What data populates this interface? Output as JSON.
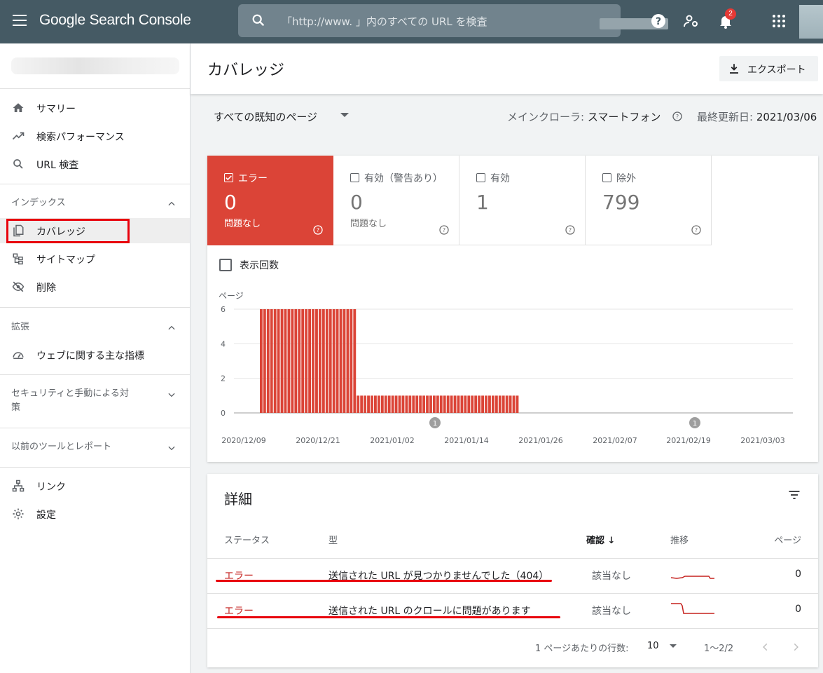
{
  "app": {
    "logo_text": "Google Search Console"
  },
  "search": {
    "placeholder": "「http://www.               」内のすべての URL を検査"
  },
  "topbar": {
    "notifications_count": "2",
    "icons": [
      "menu-icon",
      "search-icon",
      "help-icon",
      "admin-icon",
      "bell-icon",
      "apps-icon"
    ]
  },
  "sidebar": {
    "top_items": [
      {
        "label": "サマリー",
        "icon": "home-icon"
      },
      {
        "label": "検索パフォーマンス",
        "icon": "trending-icon"
      },
      {
        "label": "URL 検査",
        "icon": "search-icon"
      }
    ],
    "index_section": "インデックス",
    "index_items": [
      {
        "label": "カバレッジ",
        "icon": "copy-icon",
        "active": true
      },
      {
        "label": "サイトマップ",
        "icon": "sitemap-icon"
      },
      {
        "label": "削除",
        "icon": "visibility-off-icon"
      }
    ],
    "enhancements_section": "拡張",
    "enhancements_items": [
      {
        "label": "ウェブに関する主な指標",
        "icon": "speed-icon"
      }
    ],
    "security_section": "セキュリティと手動による対策",
    "legacy_section": "以前のツールとレポート",
    "bottom_items": [
      {
        "label": "リンク",
        "icon": "links-icon"
      },
      {
        "label": "設定",
        "icon": "settings-icon"
      }
    ]
  },
  "header": {
    "title": "カバレッジ",
    "export_label": "エクスポート"
  },
  "filter": {
    "pages_select": "すべての既知のページ",
    "crawler_label": "メインクローラ:",
    "crawler_value": "スマートフォン",
    "updated_label": "最終更新日:",
    "updated_value": "2021/03/06"
  },
  "tiles": [
    {
      "label": "エラー",
      "count": "0",
      "sub": "問題なし",
      "checked": true,
      "color": "#db4437"
    },
    {
      "label": "有効（警告あり）",
      "count": "0",
      "sub": "問題なし",
      "checked": false
    },
    {
      "label": "有効",
      "count": "1",
      "sub": "",
      "checked": false
    },
    {
      "label": "除外",
      "count": "799",
      "sub": "",
      "checked": false
    }
  ],
  "impressions_label": "表示回数",
  "chart_data": {
    "type": "bar",
    "ylabel": "ページ",
    "yticks": [
      0,
      2,
      4,
      6
    ],
    "ylim": [
      0,
      6
    ],
    "xtick_labels": [
      "2020/12/09",
      "2020/12/21",
      "2021/01/02",
      "2021/01/14",
      "2021/01/26",
      "2021/02/07",
      "2021/02/19",
      "2021/03/03"
    ],
    "series": [
      {
        "values": [
          6,
          6,
          6,
          6,
          6,
          6,
          6,
          6,
          6,
          6,
          6,
          6,
          6,
          6,
          6,
          6,
          6,
          6,
          6,
          6,
          6,
          6,
          6,
          6,
          6,
          6,
          6,
          6,
          1,
          1,
          1,
          1,
          1,
          1,
          1,
          1,
          1,
          1,
          1,
          1,
          1,
          1,
          1,
          1,
          1,
          1,
          1,
          1,
          1,
          1,
          1,
          1,
          1,
          1,
          1,
          1,
          1,
          1,
          1,
          1,
          1,
          1,
          1,
          1,
          1,
          1,
          1,
          1,
          1,
          1,
          1,
          1,
          1,
          1,
          1,
          0,
          0,
          0,
          0,
          0,
          0,
          0,
          0,
          0,
          0,
          0,
          0,
          0,
          0,
          0,
          0,
          0,
          0,
          0,
          0,
          0,
          0,
          0,
          0,
          0,
          0,
          0,
          0,
          0
        ]
      }
    ],
    "bar_color": "#db4437",
    "annotations": [
      "1",
      "1"
    ],
    "grid": true
  },
  "details": {
    "title": "詳細",
    "columns": {
      "status": "ステータス",
      "type": "型",
      "verify": "確認",
      "trend": "推移",
      "pages": "ページ"
    },
    "rows": [
      {
        "status": "エラー",
        "type": "送信された URL が見つかりませんでした（404）",
        "verify": "該当なし",
        "pages": "0"
      },
      {
        "status": "エラー",
        "type": "送信された URL のクロールに問題があります",
        "verify": "該当なし",
        "pages": "0"
      }
    ],
    "rows_per_page_label": "1 ページあたりの行数:",
    "rows_per_page_value": "10",
    "range": "1〜2/2"
  },
  "colors": {
    "topbar": "#455a64",
    "error": "#db4437",
    "highlight": "#e8000b"
  }
}
